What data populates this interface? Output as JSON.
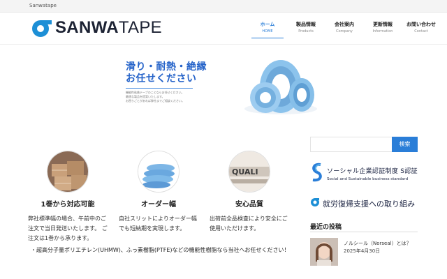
{
  "topbar": {
    "site_name": "Sanwatape"
  },
  "header": {
    "logo_text_bold": "SANWA",
    "logo_text_thin": "TAPE"
  },
  "nav": [
    {
      "jp": "ホーム",
      "en": "HOME",
      "active": true
    },
    {
      "jp": "製品情報",
      "en": "Products"
    },
    {
      "jp": "会社案内",
      "en": "Company"
    },
    {
      "jp": "更新情報",
      "en": "Information"
    },
    {
      "jp": "お問い合わせ",
      "en": "Contact"
    }
  ],
  "hero": {
    "title_line1": "滑り・耐熱・絶縁",
    "title_line2": "お任せください",
    "small_line1": "機能性粘着テープのことならお任せください。",
    "small_line2": "最適な製品を提案いたします。",
    "small_line3": "お困りごとがあれば弊社までご相談ください。"
  },
  "features": [
    {
      "title": "1巻から対応可能",
      "desc": "弊社標準幅の場合、午前中のご注文で当日発送いたします。 ご注文は1巻から承ります。",
      "icon": "cardboard-boxes"
    },
    {
      "title": "オーダー幅",
      "desc": "自社スリットによりオーダー幅でも短納期を実現します。",
      "icon": "tape-rolls"
    },
    {
      "title": "安心品質",
      "desc": "出荷前全品検査により安全にご使用いただけます。",
      "icon": "quality-blocks"
    }
  ],
  "note": "・超高分子量ポリエチレン(UHMW)、ふっ素樹脂(PTFE)などの機能性樹脂なら当社へお任せください！",
  "sidebar": {
    "search_button": "検索",
    "search_placeholder": "",
    "cert_title": "ソーシャル企業認証制度 S認証",
    "cert_subtitle": "Social and Sustainable business standard",
    "employment_text": "就労復帰支援への取り組み",
    "recent_heading": "最近の投稿",
    "recent_posts": [
      {
        "title": "ノルシール（Norseal）とは？",
        "date": "2025年4月30日"
      }
    ]
  },
  "colors": {
    "accent": "#2a7ed8",
    "hero_blue": "#2563c9",
    "tape_blue": "#7fb9e8"
  }
}
